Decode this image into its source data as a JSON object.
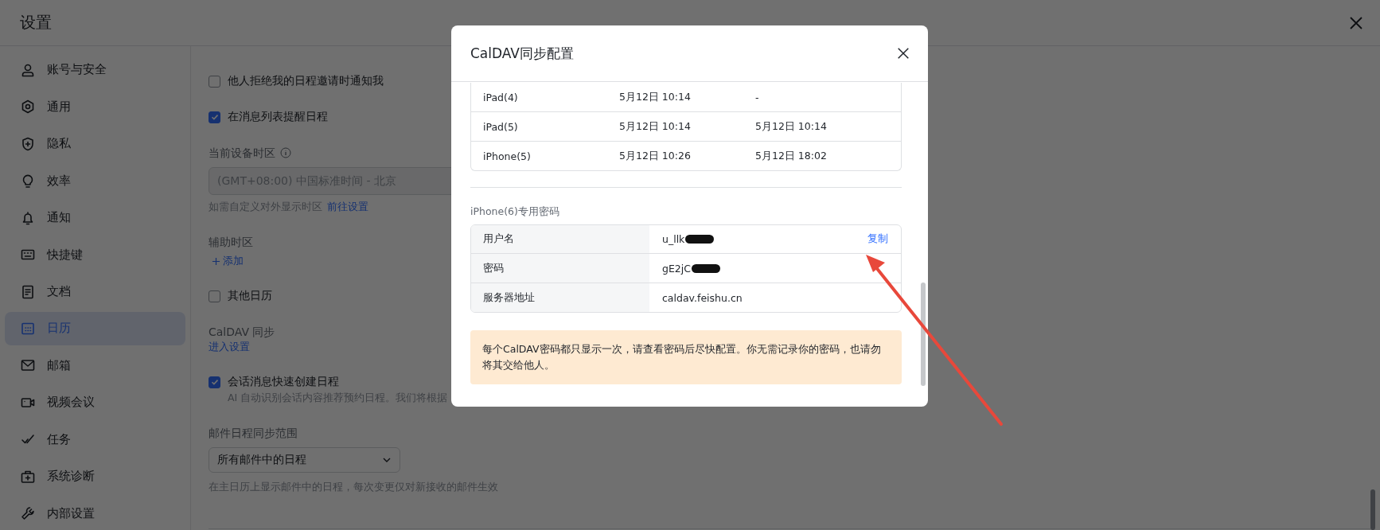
{
  "window": {
    "title": "设置"
  },
  "sidebar": {
    "items": [
      {
        "label": "账号与安全",
        "selected": false
      },
      {
        "label": "通用",
        "selected": false
      },
      {
        "label": "隐私",
        "selected": false
      },
      {
        "label": "效率",
        "selected": false
      },
      {
        "label": "通知",
        "selected": false
      },
      {
        "label": "快捷键",
        "selected": false
      },
      {
        "label": "文档",
        "selected": false
      },
      {
        "label": "日历",
        "selected": true
      },
      {
        "label": "邮箱",
        "selected": false
      },
      {
        "label": "视频会议",
        "selected": false
      },
      {
        "label": "任务",
        "selected": false
      },
      {
        "label": "系统诊断",
        "selected": false
      },
      {
        "label": "内部设置",
        "selected": false
      }
    ]
  },
  "settings": [
    {
      "kind": "checkbox",
      "label": "他人拒绝我的日程邀请时通知我",
      "checked": false
    },
    {
      "kind": "checkbox",
      "label": "在消息列表提醒日程",
      "checked": true
    },
    {
      "kind": "timezone",
      "title": "当前设备时区",
      "value": "(GMT+08:00) 中国标准时间 - 北京",
      "disabled": true,
      "hint": "如需自定义对外显示时区",
      "link": "前往设置"
    },
    {
      "kind": "add",
      "title": "辅助时区",
      "link": "添加"
    },
    {
      "kind": "checkbox",
      "label": "其他日历",
      "checked": false
    },
    {
      "kind": "section",
      "title": "CalDAV 同步",
      "link": "进入设置"
    },
    {
      "kind": "checkbox",
      "label": "会话消息快速创建日程",
      "checked": true,
      "description": "AI 自动识别会话内容推荐预约日程。我们将根据"
    },
    {
      "kind": "dropdown",
      "title": "邮件日程同步范围",
      "value": "所有邮件中的日程",
      "hint": "在主日历上显示邮件中的日程，每次变更仅对新接收的邮件生效"
    }
  ],
  "dialog": {
    "title": "CalDAV同步配置",
    "devices": {
      "rows": [
        [
          "iPad(4)",
          "5月12日 10:14",
          "-"
        ],
        [
          "iPad(5)",
          "5月12日 10:14",
          "5月12日 10:14"
        ],
        [
          "iPhone(5)",
          "5月12日 10:26",
          "5月12日 18:02"
        ]
      ]
    },
    "credentials": {
      "title": "iPhone(6)专用密码",
      "rows": [
        {
          "label": "用户名",
          "value": "u_llk",
          "redacted": true,
          "action": "复制"
        },
        {
          "label": "密码",
          "value": "gE2jC",
          "redacted": true
        },
        {
          "label": "服务器地址",
          "value": "caldav.feishu.cn"
        }
      ]
    },
    "notice": "每个CalDAV密码都只显示一次，请查看密码后尽快配置。你无需记录你的密码，也请勿将其交给他人。"
  }
}
